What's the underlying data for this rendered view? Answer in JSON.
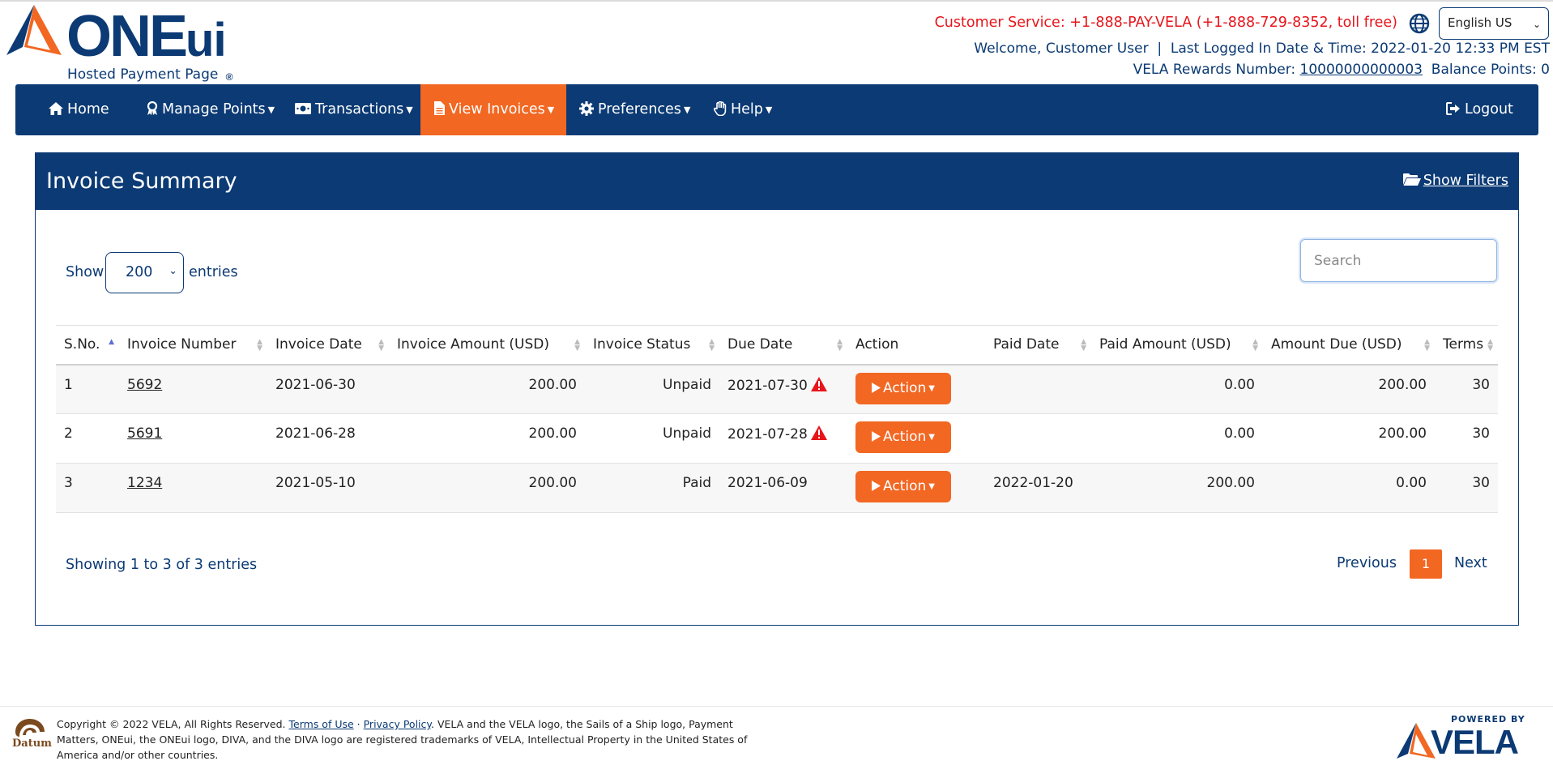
{
  "header": {
    "brand_main": "ONE",
    "brand_ui": "ui",
    "brand_reg": "®",
    "subtitle": "Hosted Payment Page",
    "customer_service": "Customer Service: +1-888-PAY-VELA (+1-888-729-8352, toll free)",
    "language": "English US",
    "welcome_prefix": "Welcome, ",
    "user_name": "Customer User",
    "last_login": "  |  Last Logged In Date & Time: 2022-01-20 12:33 PM EST",
    "rewards_label": "VELA Rewards Number: ",
    "rewards_number": "10000000000003",
    "balance": "  Balance Points: 0"
  },
  "nav": {
    "home": "Home",
    "manage_points": "Manage Points",
    "transactions": "Transactions",
    "view_invoices": "View Invoices",
    "preferences": "Preferences",
    "help": "Help",
    "logout": "Logout"
  },
  "card": {
    "title": "Invoice Summary",
    "show_filters": "Show Filters",
    "show_label": "Show",
    "entries_value": "200",
    "entries_label": "entries",
    "search_placeholder": "Search"
  },
  "table": {
    "columns": [
      "S.No.",
      "Invoice Number",
      "Invoice Date",
      "Invoice Amount (USD)",
      "Invoice Status",
      "Due Date",
      "Action",
      "Paid Date",
      "Paid Amount (USD)",
      "Amount Due (USD)",
      "Terms"
    ],
    "rows": [
      {
        "sno": "1",
        "invoice": "5692",
        "date": "2021-06-30",
        "amount": "200.00",
        "status": "Unpaid",
        "due": "2021-07-30",
        "action": "Action",
        "paid_date": "",
        "paid_amount": "0.00",
        "amount_due": "200.00",
        "terms": "30"
      },
      {
        "sno": "2",
        "invoice": "5691",
        "date": "2021-06-28",
        "amount": "200.00",
        "status": "Unpaid",
        "due": "2021-07-28",
        "action": "Action",
        "paid_date": "",
        "paid_amount": "0.00",
        "amount_due": "200.00",
        "terms": "30"
      },
      {
        "sno": "3",
        "invoice": "1234",
        "date": "2021-05-10",
        "amount": "200.00",
        "status": "Paid",
        "due": "2021-06-09",
        "action": "Action",
        "paid_date": "2022-01-20",
        "paid_amount": "200.00",
        "amount_due": "0.00",
        "terms": "30"
      }
    ]
  },
  "pagination": {
    "info": "Showing 1 to 3 of 3 entries",
    "previous": "Previous",
    "current": "1",
    "next": "Next"
  },
  "footer": {
    "datum": "Datum",
    "copyright": "Copyright © 2022 VELA, All Rights Reserved. ",
    "terms": "Terms of Use",
    "sep": " · ",
    "privacy": "Privacy Policy",
    "trademark": ". VELA and the VELA logo, the Sails of a Ship logo, Payment Matters, ONEui, the ONEui logo, DIVA, and the DIVA logo are registered trademarks of VELA, Intellectual Property in the United States of America and/or other countries.",
    "powered_by": "POWERED BY",
    "vela": "VELA"
  },
  "colors": {
    "navy": "#0b3a74",
    "orange": "#f26722",
    "red": "#e8141b",
    "green": "#1c8a1c"
  },
  "icons": [
    "home-icon",
    "award-icon",
    "money-icon",
    "file-icon",
    "gear-icon",
    "hand-icon",
    "logout-icon",
    "folder-open-icon",
    "globe-icon",
    "warning-icon",
    "play-icon"
  ]
}
